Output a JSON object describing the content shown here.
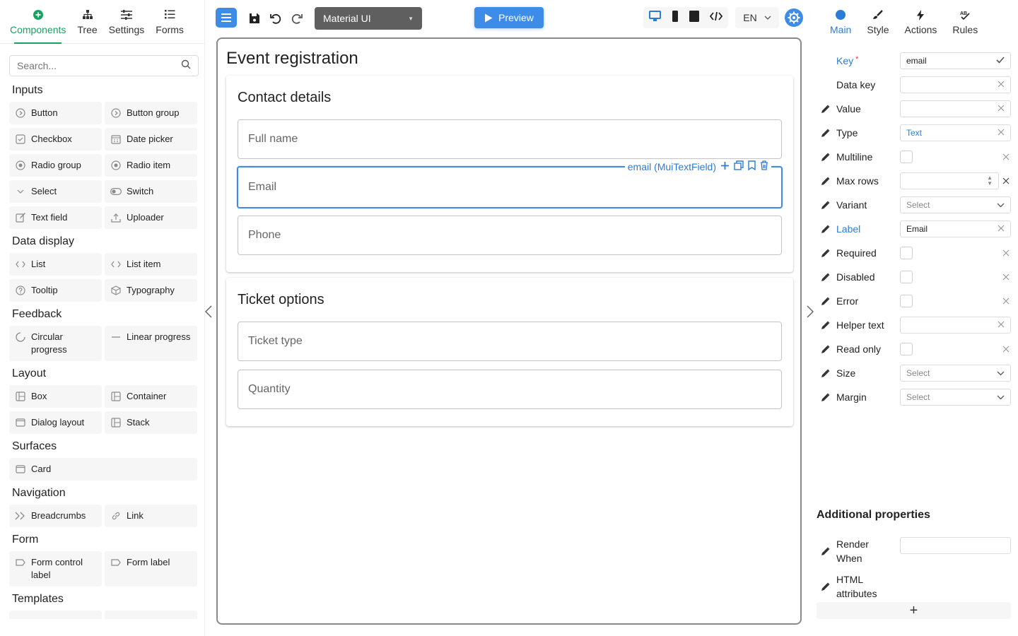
{
  "left": {
    "tabs": [
      {
        "label": "Components",
        "icon": "plus-circle-icon",
        "active": true
      },
      {
        "label": "Tree",
        "icon": "tree-icon"
      },
      {
        "label": "Settings",
        "icon": "sliders-icon"
      },
      {
        "label": "Forms",
        "icon": "list-icon"
      }
    ],
    "search_placeholder": "Search...",
    "groups": [
      {
        "title": "Inputs",
        "items": [
          "Button",
          "Button group",
          "Checkbox",
          "Date picker",
          "Radio group",
          "Radio item",
          "Select",
          "Switch",
          "Text field",
          "Uploader"
        ]
      },
      {
        "title": "Data display",
        "items": [
          "List",
          "List item",
          "Tooltip",
          "Typography"
        ]
      },
      {
        "title": "Feedback",
        "items": [
          "Circular progress",
          "Linear progress"
        ]
      },
      {
        "title": "Layout",
        "items": [
          "Box",
          "Container",
          "Dialog layout",
          "Stack"
        ]
      },
      {
        "title": "Surfaces",
        "items": [
          "Card"
        ]
      },
      {
        "title": "Navigation",
        "items": [
          "Breadcrumbs",
          "Link"
        ]
      },
      {
        "title": "Form",
        "items": [
          "Form control label",
          "Form label"
        ]
      },
      {
        "title": "Templates",
        "items": []
      }
    ]
  },
  "toolbar": {
    "library": "Material UI",
    "preview": "Preview",
    "language": "EN",
    "accent": "#3d8de8"
  },
  "canvas": {
    "title": "Event registration",
    "sections": [
      {
        "title": "Contact details",
        "fields": [
          "Full name",
          "Email",
          "Phone"
        ]
      },
      {
        "title": "Ticket options",
        "fields": [
          "Ticket type",
          "Quantity"
        ]
      }
    ],
    "selected_label": "email (MuiTextField)"
  },
  "right": {
    "tabs": [
      {
        "label": "Main",
        "active": true
      },
      {
        "label": "Style"
      },
      {
        "label": "Actions"
      },
      {
        "label": "Rules"
      }
    ],
    "props": [
      {
        "label": "Key",
        "required": true,
        "kind": "input",
        "value": "email",
        "pen": false,
        "blue": true,
        "check": true
      },
      {
        "label": "Data key",
        "kind": "input",
        "value": "",
        "pen": false
      },
      {
        "label": "Value",
        "kind": "input",
        "value": "",
        "pen": true
      },
      {
        "label": "Type",
        "kind": "input",
        "value": "Text",
        "pen": true,
        "valblue": true
      },
      {
        "label": "Multiline",
        "kind": "check",
        "pen": true
      },
      {
        "label": "Max rows",
        "kind": "number",
        "value": "",
        "pen": true
      },
      {
        "label": "Variant",
        "kind": "select",
        "value": "Select",
        "pen": true
      },
      {
        "label": "Label",
        "kind": "input",
        "value": "Email",
        "pen": true,
        "blue": true
      },
      {
        "label": "Required",
        "kind": "check",
        "pen": true
      },
      {
        "label": "Disabled",
        "kind": "check",
        "pen": true
      },
      {
        "label": "Error",
        "kind": "check",
        "pen": true
      },
      {
        "label": "Helper text",
        "kind": "input",
        "value": "",
        "pen": true
      },
      {
        "label": "Read only",
        "kind": "check",
        "pen": true
      },
      {
        "label": "Size",
        "kind": "select",
        "value": "Select",
        "pen": true
      },
      {
        "label": "Margin",
        "kind": "select",
        "value": "Select",
        "pen": true
      }
    ],
    "additional_title": "Additional properties",
    "additional": [
      {
        "label": "Render When"
      },
      {
        "label": "HTML attributes"
      }
    ],
    "add_button": "+"
  }
}
